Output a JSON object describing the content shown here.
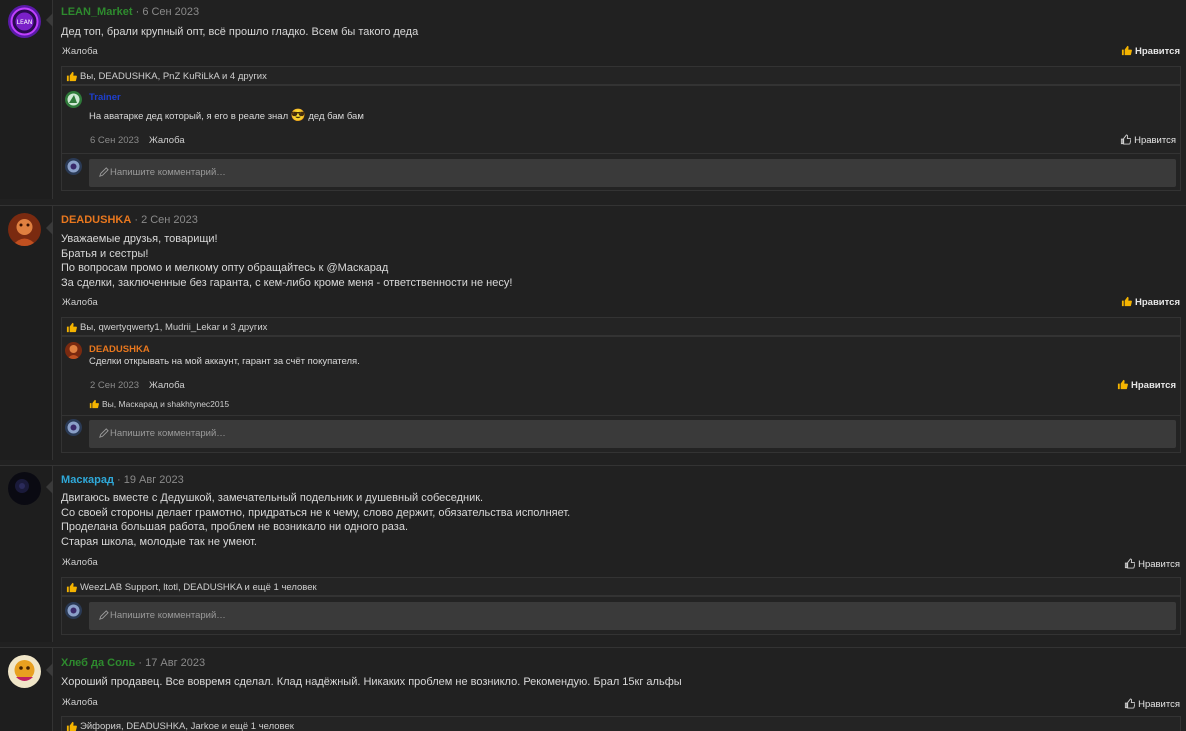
{
  "posts": [
    {
      "author": "LEAN_Market",
      "author_color": "#2e8b2e",
      "date": "· 6 Сен 2023",
      "avatar_text": "LEAN",
      "message": [
        "Дед топ, брали крупный опт, всё прошло гладко. Всем бы такого деда"
      ],
      "report_label": "Жалоба",
      "like_label": "Нравится",
      "likes_text": "Вы, DEADUSHKA, PnZ KuRiLkA и 4 других",
      "comment": {
        "author": "Trainer",
        "author_color": "#1e3fcf",
        "text_before": "На аватарке дед который, я его в реале знал",
        "emoji": "😎",
        "text_after": "дед бам бам",
        "date": "6 Сен 2023",
        "report_label": "Жалоба",
        "like_label": "Нравится"
      },
      "comment_placeholder": "Напишите комментарий…"
    },
    {
      "author": "DEADUSHKA",
      "author_color": "#e8771e",
      "date": "· 2 Сен 2023",
      "message": [
        "Уважаемые друзья, товарищи!",
        "Братья и сестры!",
        "По вопросам промо и мелкому опту обращайтесь к @Маскарад",
        "За сделки, заключенные без гаранта, с кем-либо кроме меня - ответственности не несу!"
      ],
      "report_label": "Жалоба",
      "like_label": "Нравится",
      "likes_text": "Вы, qwertyqwerty1, Mudrii_Lekar и 3 других",
      "comment": {
        "author": "DEADUSHKA",
        "author_color": "#e8771e",
        "text": "Сделки открывать на мой аккаунт, гарант за счёт покупателя.",
        "date": "2 Сен 2023",
        "report_label": "Жалоба",
        "like_label": "Нравится",
        "likes_text": "Вы, Маскарад и shakhtynec2015"
      },
      "comment_placeholder": "Напишите комментарий…"
    },
    {
      "author": "Маскарад",
      "author_color": "#2fa8d8",
      "date": "· 19 Авг 2023",
      "message": [
        "Двигаюсь вместе с Дедушкой, замечательный подельник и душевный собеседник.",
        "Со своей стороны делает грамотно, придраться не к чему, слово держит, обязательства исполняет.",
        "Проделана большая работа, проблем не возникало ни одного раза.",
        "Старая школа, молодые так не умеют."
      ],
      "report_label": "Жалоба",
      "like_label": "Нравится",
      "likes_text": "WeezLAB Support, ltotl, DEADUSHKA и ещё 1 человек",
      "comment_placeholder": "Напишите комментарий…"
    },
    {
      "author": "Хлеб да Соль",
      "author_color": "#2e8b2e",
      "date": "· 17 Авг 2023",
      "message": [
        "Хороший продавец. Все вовремя сделал. Клад надёжный. Никаких проблем не возникло. Рекомендую. Брал 15кг альфы"
      ],
      "report_label": "Жалоба",
      "like_label": "Нравится",
      "likes_text": "Эйфория, DEADUSHKA, Jarkoe и ещё 1 человек"
    }
  ]
}
